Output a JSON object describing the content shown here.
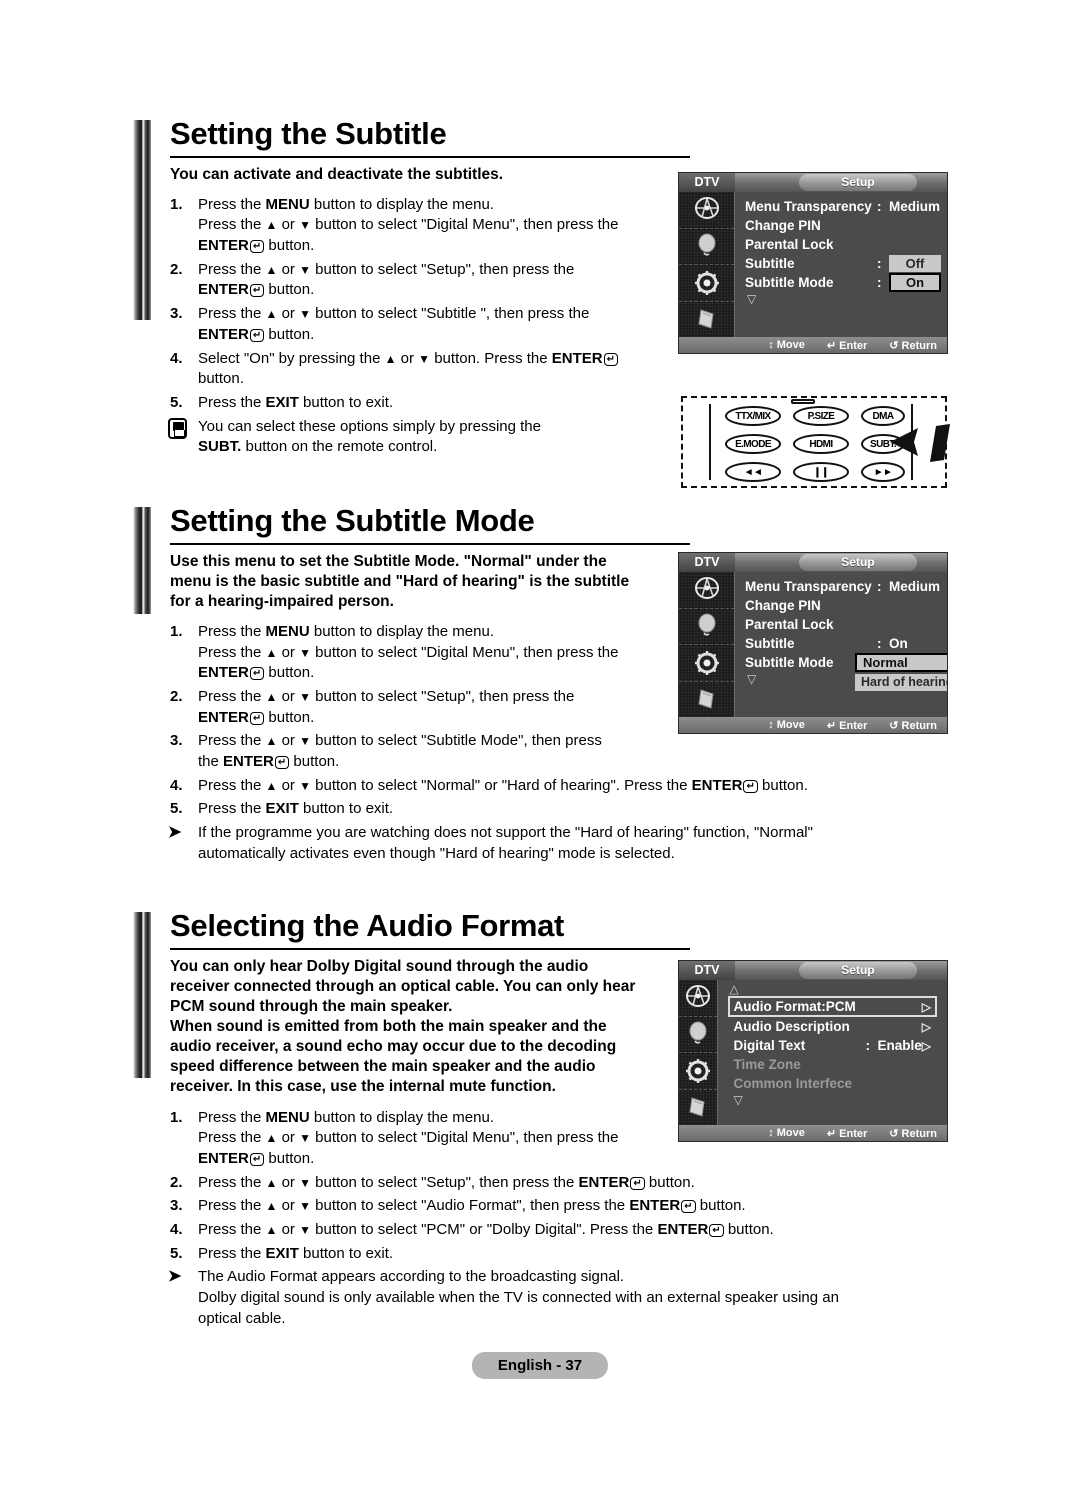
{
  "page": {
    "footer_label": "English - 37"
  },
  "sections": [
    {
      "heading": "Setting the Subtitle",
      "intro": "You can activate and deactivate the subtitles.",
      "steps": [
        {
          "num": "1.",
          "lines": [
            "Press the MENU button to display the menu.",
            "Press the ▲ or ▼ button to select \"Digital Menu\", then press the",
            "ENTER↵ button."
          ]
        },
        {
          "num": "2.",
          "lines": [
            "Press the ▲ or ▼ button to select \"Setup\", then press the",
            "ENTER↵ button."
          ]
        },
        {
          "num": "3.",
          "lines": [
            "Press the ▲ or ▼ button to select \"Subtitle \", then press the",
            "ENTER↵ button."
          ]
        },
        {
          "num": "4.",
          "lines": [
            "Select \"On\" by pressing the ▲ or ▼ button. Press the ENTER↵",
            "button."
          ]
        },
        {
          "num": "5.",
          "lines": [
            "Press the EXIT button to exit."
          ]
        }
      ],
      "note": {
        "icon": "hand-press-icon",
        "lines": [
          "You can select these options simply by pressing the",
          "SUBT. button on the remote control."
        ]
      }
    },
    {
      "heading": "Setting the Subtitle Mode",
      "intro": "Use this menu to set the Subtitle Mode. \"Normal\" under the menu is the basic subtitle and \"Hard of hearing\" is the subtitle for a hearing-impaired person.",
      "steps": [
        {
          "num": "1.",
          "lines": [
            "Press the MENU button to display the menu.",
            "Press the ▲ or ▼ button to select \"Digital Menu\", then press the",
            "ENTER↵ button."
          ]
        },
        {
          "num": "2.",
          "lines": [
            "Press the ▲ or ▼ button to select \"Setup\", then press the",
            "ENTER↵ button."
          ]
        },
        {
          "num": "3.",
          "lines": [
            "Press the ▲ or ▼ button to select \"Subtitle  Mode\", then press",
            "the ENTER↵ button."
          ]
        },
        {
          "num": "4.",
          "lines": [
            "Press the ▲ or ▼ button to select \"Normal\" or \"Hard of hearing\". Press the ENTER↵ button."
          ]
        },
        {
          "num": "5.",
          "lines": [
            "Press the EXIT button to exit."
          ]
        }
      ],
      "note": {
        "icon": "arrow-bullet-icon",
        "lines": [
          "If the programme you are watching does not support the \"Hard of hearing\" function, \"Normal\"",
          "automatically activates even though \"Hard of hearing\" mode is selected."
        ]
      }
    },
    {
      "heading": "Selecting the Audio Format",
      "intro": "You can only hear Dolby Digital sound through the audio receiver connected through an optical cable. You can only hear PCM sound through the main speaker.\nWhen sound is emitted from both the main speaker and the audio receiver, a sound echo may occur due to the decoding speed difference between the main speaker and the audio receiver. In this case, use the internal mute function.",
      "steps": [
        {
          "num": "1.",
          "lines": [
            "Press the MENU button to display the menu.",
            "Press the ▲ or ▼ button to select \"Digital Menu\", then press the",
            "ENTER↵ button."
          ]
        },
        {
          "num": "2.",
          "lines": [
            "Press the ▲ or ▼ button to select \"Setup\", then press the ENTER↵ button."
          ]
        },
        {
          "num": "3.",
          "lines": [
            "Press the ▲ or ▼ button to select \"Audio Format\", then press the ENTER↵ button."
          ]
        },
        {
          "num": "4.",
          "lines": [
            "Press the ▲ or ▼ button to select \"PCM\" or \"Dolby Digital\". Press the ENTER↵ button."
          ]
        },
        {
          "num": "5.",
          "lines": [
            "Press the EXIT button to exit."
          ]
        }
      ],
      "note": {
        "icon": "arrow-bullet-icon",
        "lines": [
          "The Audio Format appears according to the broadcasting signal.",
          "Dolby digital sound is only available when the TV is connected with an external speaker using an",
          "optical cable."
        ]
      }
    }
  ],
  "osd_common": {
    "source_label": "DTV",
    "tab_label": "Setup",
    "bottom": {
      "move": "↕ Move",
      "enter": "↵ Enter",
      "return": "↺ Return"
    },
    "rail_icons": [
      "satellite-icon",
      "audio-icon",
      "setup-gear-icon",
      "remote-hand-icon"
    ]
  },
  "osd1": {
    "rows": [
      {
        "label": "Menu Transparency",
        "colon": ":",
        "value": "Medium",
        "style": "plain"
      },
      {
        "label": "Change PIN",
        "colon": "",
        "value": "",
        "style": "plain"
      },
      {
        "label": "Parental Lock",
        "colon": "",
        "value": "",
        "style": "plain"
      },
      {
        "label": "Subtitle",
        "colon": ":",
        "value": "Off",
        "style": "pill"
      },
      {
        "label": "Subtitle  Mode",
        "colon": ":",
        "value": "On",
        "style": "pill-selected"
      }
    ],
    "scroll_down": "▽"
  },
  "osd2": {
    "rows": [
      {
        "label": "Menu Transparency",
        "colon": ":",
        "value": "Medium",
        "style": "plain"
      },
      {
        "label": "Change PIN",
        "colon": "",
        "value": "",
        "style": "plain"
      },
      {
        "label": "Parental Lock",
        "colon": "",
        "value": "",
        "style": "plain"
      },
      {
        "label": "Subtitle",
        "colon": ":",
        "value": "On",
        "style": "plain"
      },
      {
        "label": "Subtitle  Mode",
        "colon": "",
        "value": "",
        "style": "plain"
      }
    ],
    "dropdown": {
      "selected": "Normal",
      "option": "Hard of hearing"
    },
    "scroll_down": "▽"
  },
  "osd3": {
    "scroll_up": "△",
    "rows": [
      {
        "label": "Audio Format",
        "colon": ":",
        "value": "PCM",
        "style": "highlight",
        "submenu": "▷"
      },
      {
        "label": "Audio Description",
        "colon": "",
        "value": "",
        "style": "plain",
        "submenu": "▷"
      },
      {
        "label": "Digital Text",
        "colon": ":",
        "value": "Enable",
        "style": "plain",
        "submenu": "▷"
      },
      {
        "label": "Time Zone",
        "colon": "",
        "value": "",
        "style": "dim",
        "submenu": ""
      },
      {
        "label": "Common Interfece",
        "colon": "",
        "value": "",
        "style": "dim",
        "submenu": ""
      }
    ],
    "scroll_down": "▽"
  },
  "remote": {
    "buttons": [
      [
        "TTX/MIX",
        "P.SIZE",
        "DMA"
      ],
      [
        "E.MODE",
        "HDMI",
        "SUBT."
      ],
      [
        "◄◄",
        "❙❙",
        "►►"
      ]
    ],
    "callout_target": "SUBT."
  }
}
